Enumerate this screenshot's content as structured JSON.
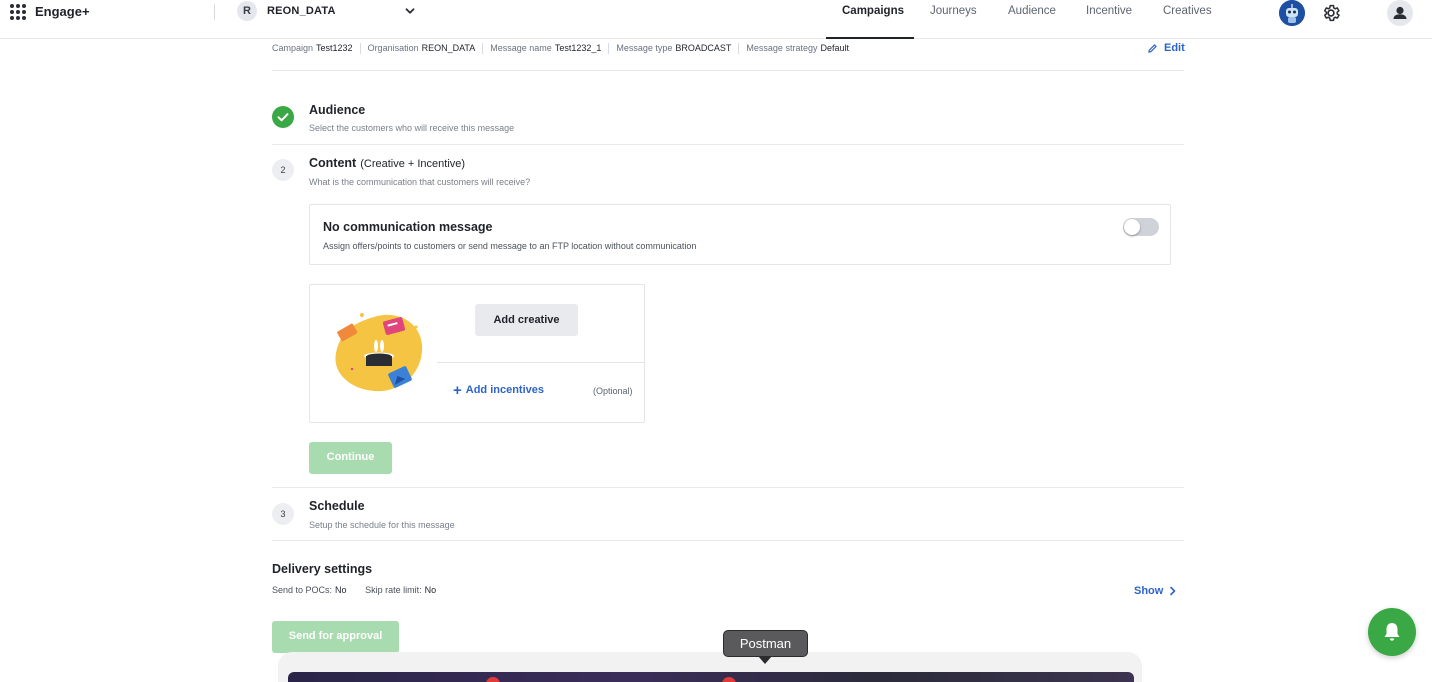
{
  "app": {
    "brand": "Engage+"
  },
  "org": {
    "initial": "R",
    "name": "REON_DATA"
  },
  "nav": {
    "items": [
      "Campaigns",
      "Journeys",
      "Audience",
      "Incentive",
      "Creatives"
    ],
    "active": "Campaigns"
  },
  "meta": {
    "campaign_label": "Campaign",
    "campaign": "Test1232",
    "org_label": "Organisation",
    "org": "REON_DATA",
    "message_name_label": "Message name",
    "message_name": "Test1232_1",
    "message_type_label": "Message type",
    "message_type": "BROADCAST",
    "strategy_label": "Message strategy",
    "strategy": "Default",
    "edit_label": "Edit"
  },
  "steps": {
    "audience": {
      "title": "Audience",
      "subtitle": "Select the customers who will receive this message"
    },
    "content": {
      "number": "2",
      "title": "Content",
      "suffix": "(Creative + Incentive)",
      "subtitle": "What is the communication that customers will receive?"
    },
    "schedule": {
      "number": "3",
      "title": "Schedule",
      "subtitle": "Setup the schedule for this message"
    }
  },
  "no_comm": {
    "title": "No communication message",
    "subtitle": "Assign offers/points to customers or send message to an FTP location without communication",
    "enabled": false
  },
  "creative_card": {
    "add_creative": "Add creative",
    "add_incentives": "Add incentives",
    "optional": "(Optional)"
  },
  "continue_label": "Continue",
  "delivery": {
    "title": "Delivery settings",
    "poc_label": "Send to POCs:",
    "poc_value": "No",
    "skip_label": "Skip rate limit:",
    "skip_value": "No",
    "show_label": "Show"
  },
  "send_for_approval": "Send for approval",
  "dock_tooltip": "Postman",
  "colors": {
    "accent_blue": "#2d64c8",
    "success_green": "#3aa845",
    "disabled_green": "#a9dbb0"
  }
}
